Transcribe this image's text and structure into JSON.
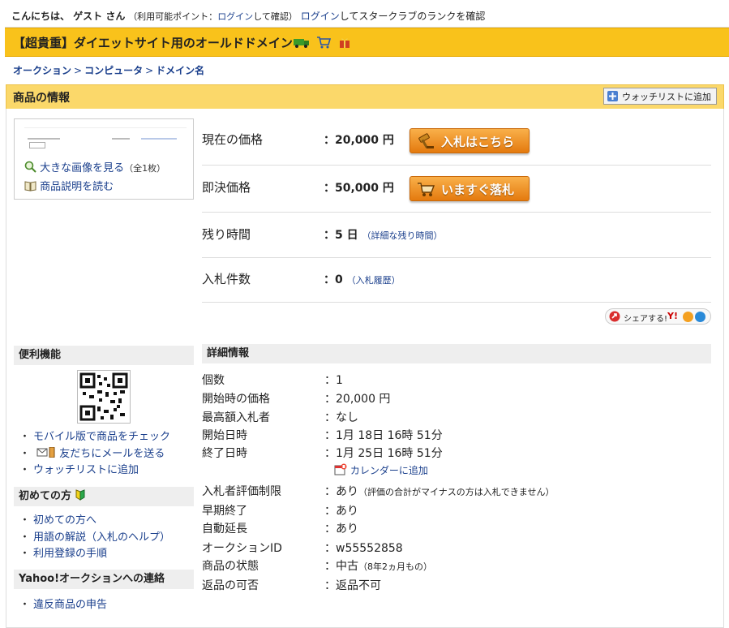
{
  "greeting": {
    "hello": "こんにちは、 ゲスト さん",
    "points_prefix": "（利用可能ポイント：",
    "points_login": "ログイン",
    "points_suffix": "して確認）",
    "star_login": "ログイン",
    "star_suffix": "してスタークラブのランクを確認"
  },
  "title": "【超貴重】ダイエットサイト用のオールドドメイン",
  "title_icons": [
    "free-shipping-icon",
    "cart-icon",
    "gift-icon"
  ],
  "breadcrumb": [
    "オークション",
    "コンピュータ",
    "ドメイン名"
  ],
  "section_title": "商品の情報",
  "watchlist_button": "ウォッチリストに追加",
  "thumb_links": {
    "view_image": "大きな画像を見る",
    "view_image_count": "（全1枚）",
    "read_description": "商品説明を読む"
  },
  "price_rows": [
    {
      "label": "現在の価格",
      "value": "：20,000 円",
      "note": ""
    },
    {
      "label": "即決価格",
      "value": "：50,000 円",
      "note": ""
    },
    {
      "label": "残り時間",
      "value": "：5 日",
      "note": "（詳細な残り時間）"
    },
    {
      "label": "入札件数",
      "value": "：0",
      "note": "（入札履歴）"
    }
  ],
  "bid_button": "入札はこちら",
  "buynow_button": "いますぐ落札",
  "share_label": "シェアする!",
  "sidebar": {
    "tools_title": "便利機能",
    "tools_items": [
      "モバイル版で商品をチェック",
      "友だちにメールを送る",
      "ウォッチリストに追加"
    ],
    "beginner_title": "初めての方",
    "beginner_items": [
      "初めての方へ",
      "用語の解説（入札のヘルプ）",
      "利用登録の手順"
    ],
    "contact_title": "Yahoo!オークションへの連絡",
    "contact_items": [
      "違反商品の申告"
    ]
  },
  "details": {
    "title": "詳細情報",
    "rows": [
      {
        "label": "個数",
        "value": "：1",
        "note": ""
      },
      {
        "label": "開始時の価格",
        "value": "：20,000 円",
        "note": ""
      },
      {
        "label": "最高額入札者",
        "value": "：なし",
        "note": ""
      },
      {
        "label": "開始日時",
        "value": "：1月 18日 16時 51分",
        "note": ""
      },
      {
        "label": "終了日時",
        "value": "：1月 25日 16時 51分",
        "note": ""
      },
      {
        "label": "入札者評価制限",
        "value": "：あり",
        "note": "（評価の合計がマイナスの方は入札できません）"
      },
      {
        "label": "早期終了",
        "value": "：あり",
        "note": ""
      },
      {
        "label": "自動延長",
        "value": "：あり",
        "note": ""
      },
      {
        "label": "オークションID",
        "value": "：w55552858",
        "note": ""
      },
      {
        "label": "商品の状態",
        "value": "：中古",
        "note": "（8年2ヵ月もの）"
      },
      {
        "label": "返品の可否",
        "value": "：返品不可",
        "note": ""
      }
    ],
    "calendar_link": "カレンダーに追加"
  },
  "colors": {
    "accent": "#f9c21b",
    "link": "#1a3f8c",
    "button": "#e47a0e"
  }
}
